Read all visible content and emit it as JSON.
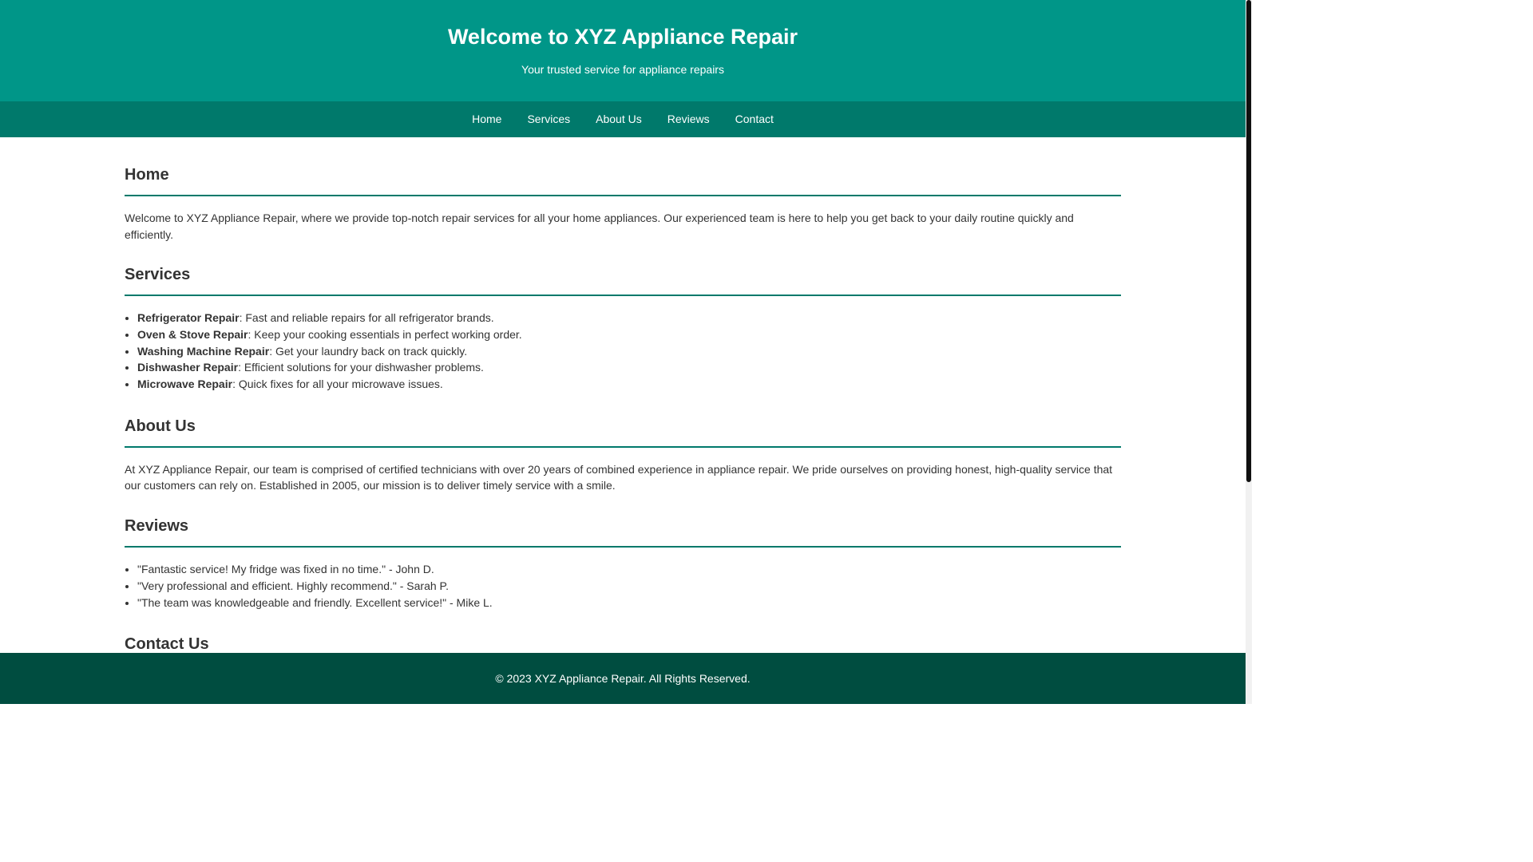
{
  "header": {
    "title": "Welcome to XYZ Appliance Repair",
    "tagline": "Your trusted service for appliance repairs"
  },
  "nav": {
    "items": [
      "Home",
      "Services",
      "About Us",
      "Reviews",
      "Contact"
    ]
  },
  "home": {
    "heading": "Home",
    "text": "Welcome to XYZ Appliance Repair, where we provide top-notch repair services for all your home appliances. Our experienced team is here to help you get back to your daily routine quickly and efficiently."
  },
  "services": {
    "heading": "Services",
    "items": [
      {
        "name": "Refrigerator Repair",
        "desc": ": Fast and reliable repairs for all refrigerator brands."
      },
      {
        "name": "Oven & Stove Repair",
        "desc": ": Keep your cooking essentials in perfect working order."
      },
      {
        "name": "Washing Machine Repair",
        "desc": ": Get your laundry back on track quickly."
      },
      {
        "name": "Dishwasher Repair",
        "desc": ": Efficient solutions for your dishwasher problems."
      },
      {
        "name": "Microwave Repair",
        "desc": ": Quick fixes for all your microwave issues."
      }
    ]
  },
  "about": {
    "heading": "About Us",
    "text": "At XYZ Appliance Repair, our team is comprised of certified technicians with over 20 years of combined experience in appliance repair. We pride ourselves on providing honest, high-quality service that our customers can rely on. Established in 2005, our mission is to deliver timely service with a smile."
  },
  "reviews": {
    "heading": "Reviews",
    "items": [
      "\"Fantastic service! My fridge was fixed in no time.\" - John D.",
      "\"Very professional and efficient. Highly recommend.\" - Sarah P.",
      "\"The team was knowledgeable and friendly. Excellent service!\" - Mike L."
    ]
  },
  "contact": {
    "heading": "Contact Us"
  },
  "footer": {
    "text": "© 2023 XYZ Appliance Repair. All Rights Reserved."
  },
  "colors": {
    "header_bg": "#009688",
    "nav_bg": "#00796b",
    "footer_bg": "#004d40",
    "divider": "#00796b"
  }
}
